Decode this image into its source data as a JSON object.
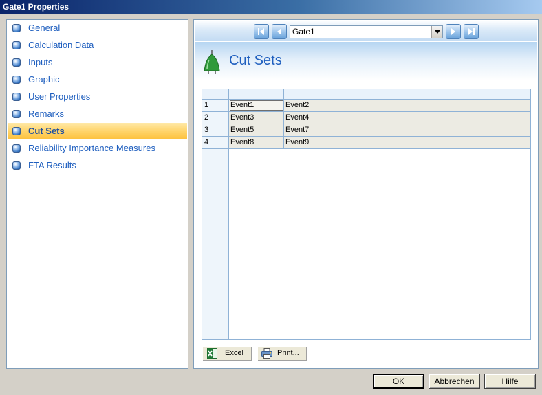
{
  "window": {
    "title": "Gate1 Properties"
  },
  "sidebar": {
    "items": [
      {
        "label": "General"
      },
      {
        "label": "Calculation Data"
      },
      {
        "label": "Inputs"
      },
      {
        "label": "Graphic"
      },
      {
        "label": "User Properties"
      },
      {
        "label": "Remarks"
      },
      {
        "label": "Cut Sets",
        "selected": true
      },
      {
        "label": "Reliability Importance Measures"
      },
      {
        "label": "FTA Results"
      }
    ]
  },
  "navigator": {
    "selected_value": "Gate1",
    "icons": [
      "first-record-icon",
      "previous-record-icon",
      "next-record-icon",
      "last-record-icon"
    ]
  },
  "section": {
    "title": "Cut Sets",
    "icon": "gate-icon"
  },
  "cut_sets_table": {
    "columns": [
      "",
      "",
      ""
    ],
    "rows": [
      [
        "1",
        "Event1",
        "Event2"
      ],
      [
        "2",
        "Event3",
        "Event4"
      ],
      [
        "3",
        "Event5",
        "Event7"
      ],
      [
        "4",
        "Event8",
        "Event9"
      ]
    ]
  },
  "actions": {
    "excel_label": "Excel",
    "print_label": "Print..."
  },
  "dialog_buttons": {
    "ok": "OK",
    "cancel": "Abbrechen",
    "help": "Hilfe"
  },
  "colors": {
    "accent": "#1f5fbf",
    "selection": "#ffd46a",
    "title_bar": "#0a246a"
  }
}
